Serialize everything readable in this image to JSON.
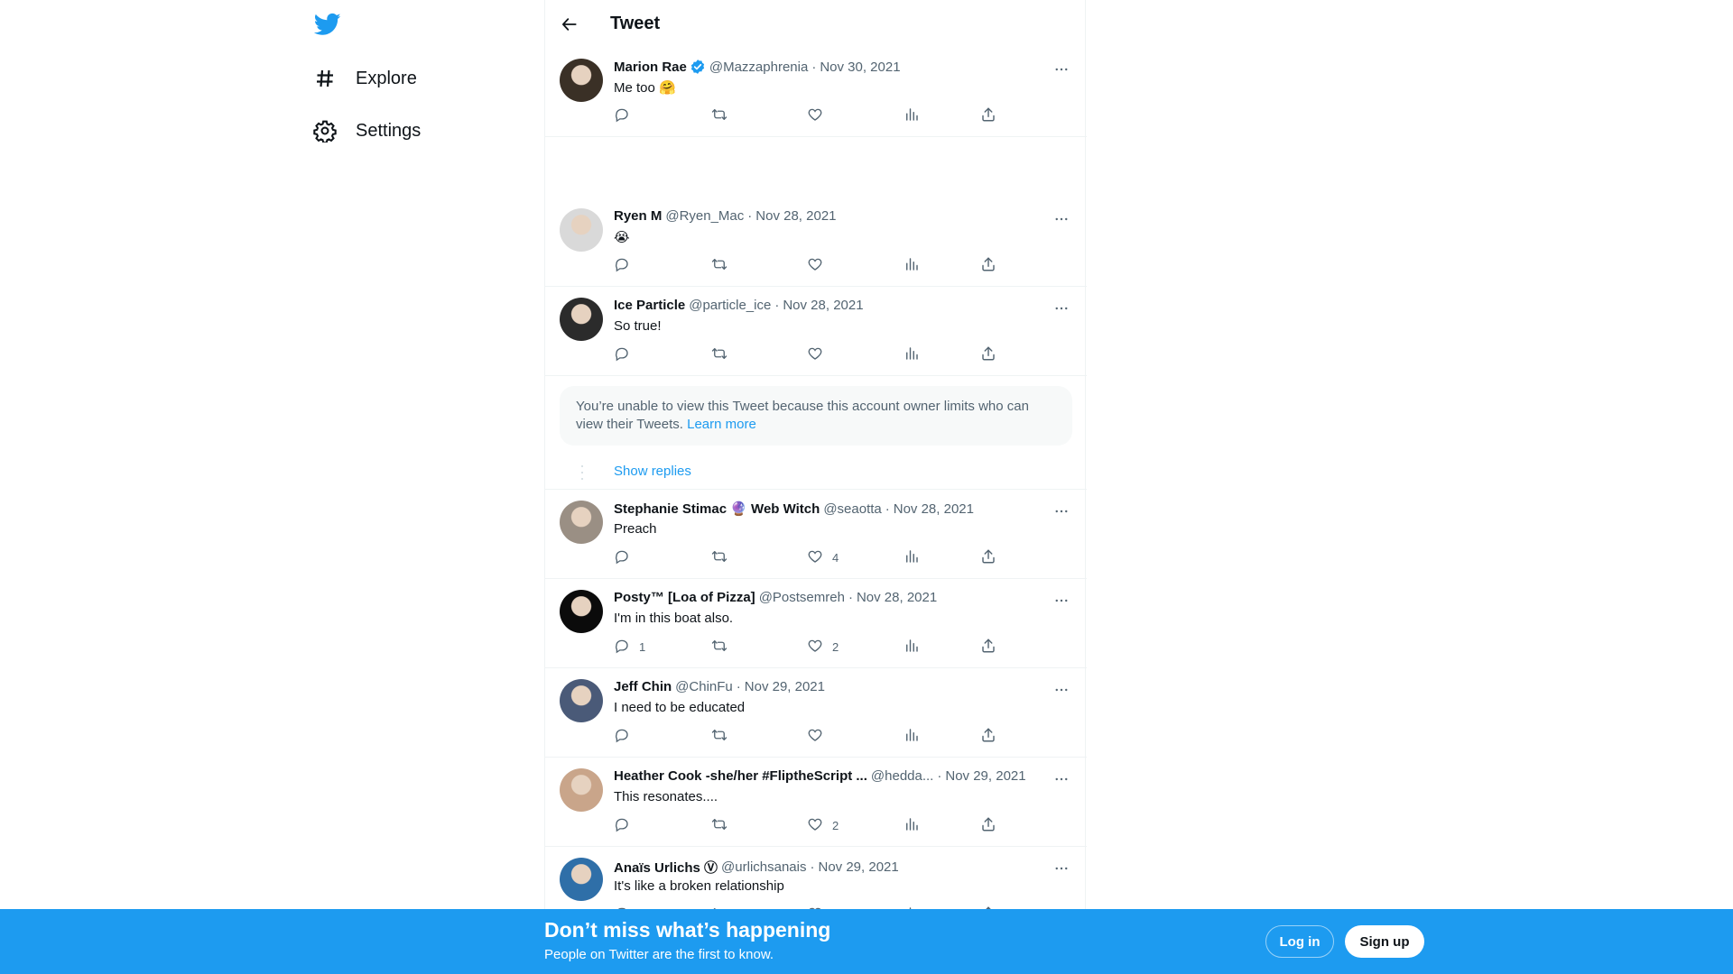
{
  "colors": {
    "accent": "#1d9bf0",
    "text": "#0f1419",
    "muted": "#536471",
    "border": "#eff3f4"
  },
  "nav": {
    "logo_icon": "twitter-bird-icon",
    "items": [
      {
        "label": "Explore",
        "icon": "hashtag-icon"
      },
      {
        "label": "Settings",
        "icon": "gear-icon"
      }
    ]
  },
  "header": {
    "title": "Tweet",
    "back_icon": "arrow-left-icon"
  },
  "tweets": [
    {
      "name": "Marion Rae",
      "verified": true,
      "handle": "@Mazzaphrenia",
      "date": "Nov 30, 2021",
      "text": "Me too 🤗",
      "replies": "",
      "likes": ""
    },
    {
      "name": "Ryen M",
      "verified": false,
      "handle": "@Ryen_Mac",
      "date": "Nov 28, 2021",
      "text": "😭",
      "replies": "",
      "likes": ""
    },
    {
      "name": "Ice Particle",
      "verified": false,
      "handle": "@particle_ice",
      "date": "Nov 28, 2021",
      "text": "So true!",
      "replies": "",
      "likes": ""
    },
    {
      "name": "Stephanie Stimac 🔮 Web Witch",
      "verified": false,
      "handle": "@seaotta",
      "date": "Nov 28, 2021",
      "text": "Preach",
      "replies": "",
      "likes": "4"
    },
    {
      "name": "Posty™ [Loa of Pizza]",
      "verified": false,
      "handle": "@Postsemreh",
      "date": "Nov 28, 2021",
      "text": "I'm in this boat also.",
      "replies": "1",
      "likes": "2"
    },
    {
      "name": "Jeff Chin",
      "verified": false,
      "handle": "@ChinFu",
      "date": "Nov 29, 2021",
      "text": "I need to be educated",
      "replies": "",
      "likes": ""
    },
    {
      "name": "Heather Cook -she/her #FliptheScript ...",
      "verified": false,
      "handle": "@hedda...",
      "date": "Nov 29, 2021",
      "text": "This resonates....",
      "replies": "",
      "likes": "2"
    },
    {
      "name": "Anaïs Urlichs Ⓥ",
      "verified": false,
      "handle": "@urlichsanais",
      "date": "Nov 29, 2021",
      "text": "It's like a broken relationship",
      "replies": "",
      "likes": ""
    }
  ],
  "unavailable": {
    "text": "You’re unable to view this Tweet because this account owner limits who can view their Tweets.",
    "link": "Learn more"
  },
  "show_replies": "Show replies",
  "banner": {
    "title": "Don’t miss what’s happening",
    "subtitle": "People on Twitter are the first to know.",
    "login": "Log in",
    "signup": "Sign up"
  }
}
